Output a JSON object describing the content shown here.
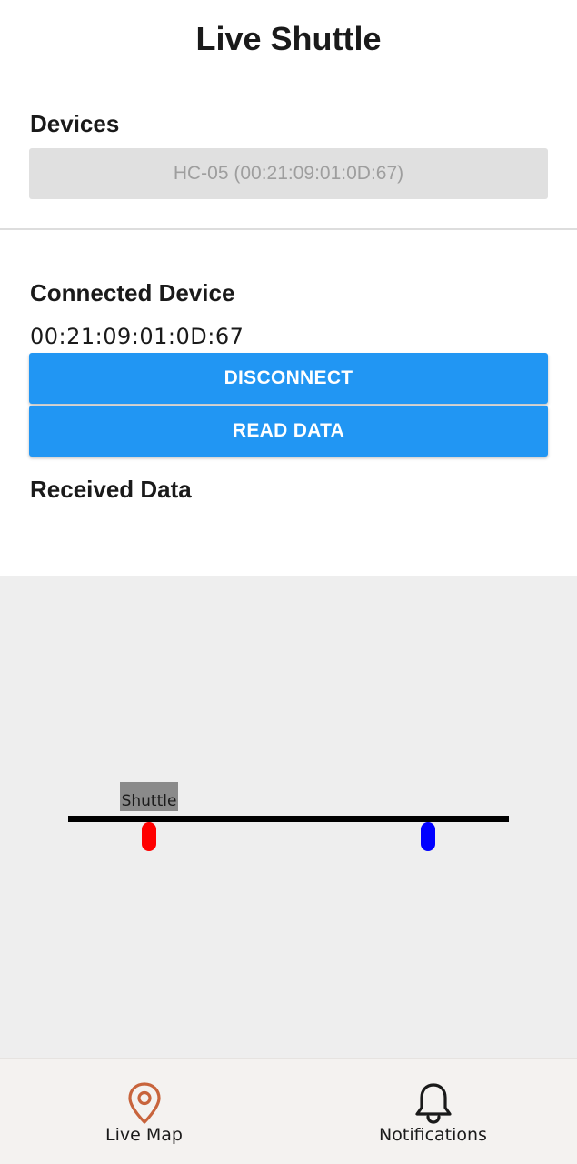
{
  "header": {
    "title": "Live Shuttle"
  },
  "devices": {
    "title": "Devices",
    "selected": "HC-05 (00:21:09:01:0D:67)"
  },
  "connected": {
    "title": "Connected Device",
    "address": "00:21:09:01:0D:67",
    "disconnect_label": "DISCONNECT",
    "read_label": "READ DATA"
  },
  "received": {
    "title": "Received Data"
  },
  "map": {
    "shuttle_label": "Shuttle",
    "markers": [
      {
        "name": "red-marker",
        "color": "#ff0000"
      },
      {
        "name": "blue-marker",
        "color": "#0000ff"
      }
    ]
  },
  "bottom_nav": {
    "items": [
      {
        "label": "Live Map",
        "icon": "map-pin-icon",
        "active": true,
        "color": "#c8643c"
      },
      {
        "label": "Notifications",
        "icon": "bell-icon",
        "active": false,
        "color": "#1a1a1a"
      }
    ]
  },
  "colors": {
    "primary": "#2196f3",
    "accent": "#c8643c"
  }
}
